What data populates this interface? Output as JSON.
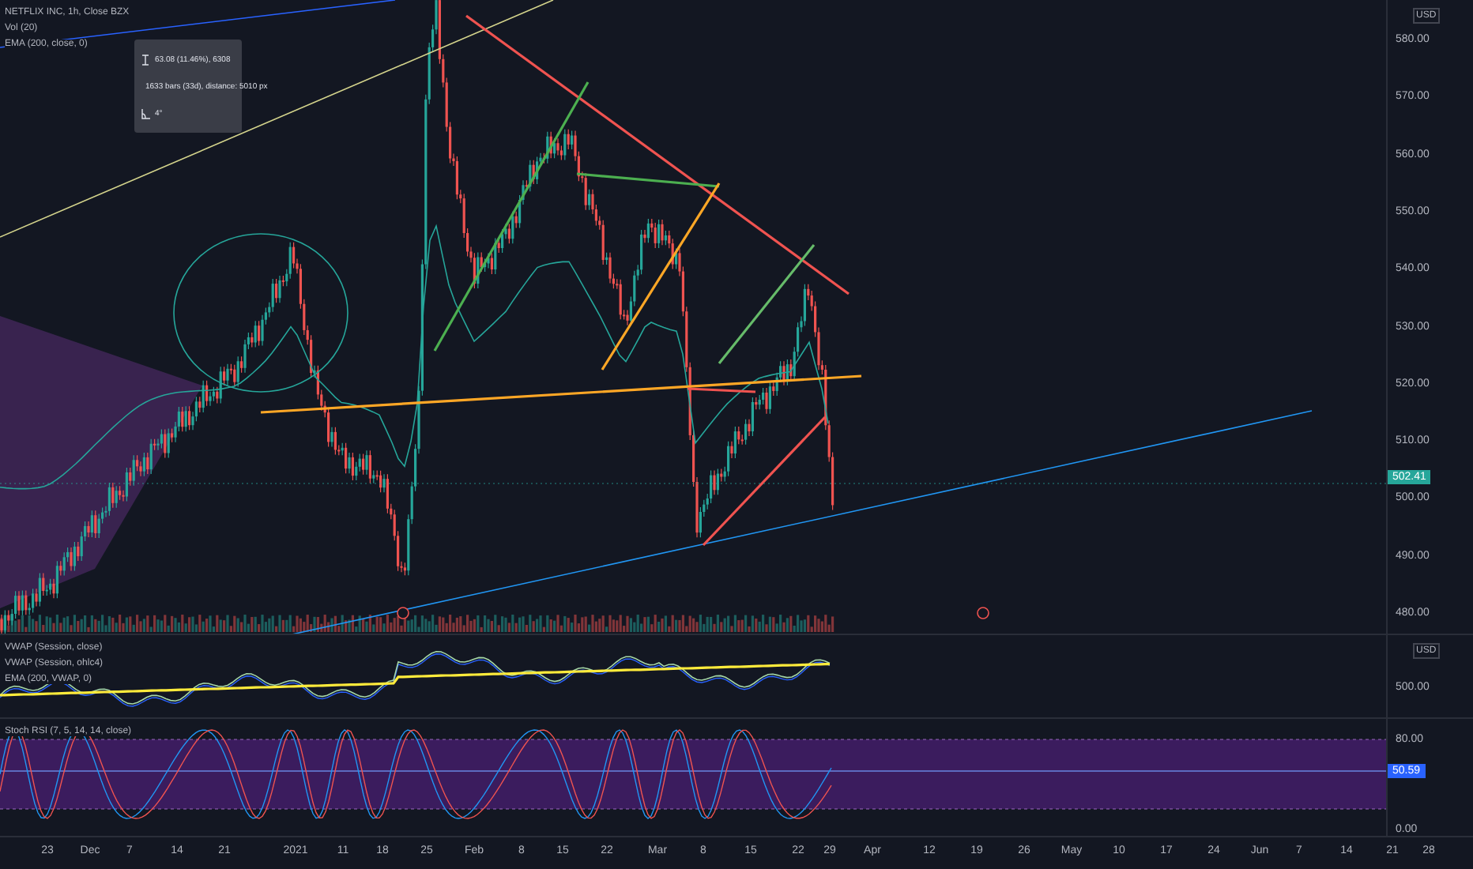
{
  "legend": [
    "NETFLIX INC, 1h, Close BZX",
    "Vol (20)",
    "EMA (200, close, 0)"
  ],
  "measure_tooltip": [
    {
      "kind": "price",
      "text": "63.08 (11.46%), 6308"
    },
    {
      "kind": "bars",
      "text": "1633 bars (33d), distance: 5010 px"
    },
    {
      "kind": "angle",
      "text": "4°"
    }
  ],
  "price_axis": {
    "currency": "USD",
    "ticks": [
      "580.00",
      "570.00",
      "560.00",
      "550.00",
      "540.00",
      "530.00",
      "520.00",
      "510.00",
      "500.00",
      "490.00",
      "480.00"
    ],
    "last_price": "502.41"
  },
  "vwap_pane": {
    "legend": [
      "VWAP (Session, close)",
      "VWAP (Session, ohlc4)",
      "EMA (200, VWAP, 0)"
    ],
    "currency": "USD",
    "ticks": [
      "500.00"
    ]
  },
  "stoch_pane": {
    "legend": "Stoch RSI (7, 5, 14, 14, close)",
    "ticks": [
      "80.00",
      "0.00"
    ],
    "last_value": "50.59"
  },
  "time_axis": [
    "23",
    "Dec",
    "7",
    "14",
    "21",
    "2021",
    "11",
    "18",
    "25",
    "Feb",
    "8",
    "15",
    "22",
    "Mar",
    "8",
    "15",
    "22",
    "29",
    "Apr",
    "12",
    "19",
    "26",
    "May",
    "10",
    "17",
    "24",
    "Jun",
    "7",
    "14",
    "21",
    "28"
  ]
}
